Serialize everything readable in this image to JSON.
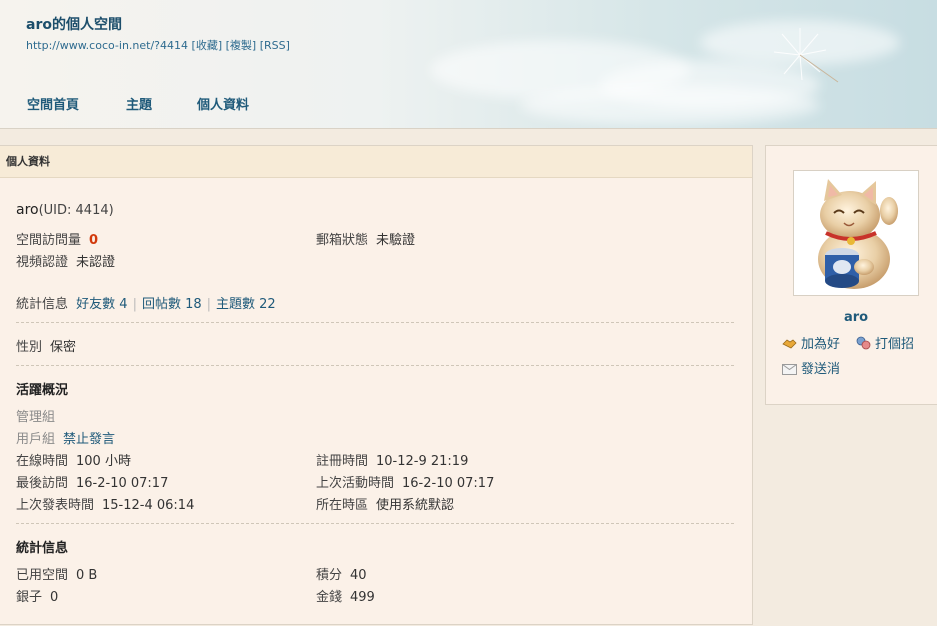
{
  "header": {
    "title": "aro的個人空間",
    "url": "http://www.coco-in.net/?4414",
    "links": [
      "[收藏]",
      "[複製]",
      "[RSS]"
    ]
  },
  "nav": [
    "空間首頁",
    "主題",
    "個人資料"
  ],
  "main": {
    "panel_title": "個人資料",
    "username": "aro",
    "uid_text": "(UID: 4414)",
    "visits_label": "空間訪問量",
    "visits_value": "0",
    "email_label": "郵箱狀態",
    "email_value": "未驗證",
    "video_label": "視頻認證",
    "video_value": "未認證",
    "stats_label": "統計信息",
    "friends": "好友數 4",
    "replies": "回帖數 18",
    "threads": "主題數 22",
    "gender_label": "性別",
    "gender_value": "保密",
    "activity_title": "活躍概況",
    "admin_group_label": "管理組",
    "user_group_label": "用戶組",
    "user_group_value": "禁止發言",
    "online_label": "在線時間",
    "online_value": "100 小時",
    "reg_label": "註冊時間",
    "reg_value": "10-12-9 21:19",
    "last_visit_label": "最後訪問",
    "last_visit_value": "16-2-10 07:17",
    "last_active_label": "上次活動時間",
    "last_active_value": "16-2-10 07:17",
    "last_post_label": "上次發表時間",
    "last_post_value": "15-12-4 06:14",
    "tz_label": "所在時區",
    "tz_value": "使用系統默認",
    "stats_title": "統計信息",
    "space_label": "已用空間",
    "space_value": "0 B",
    "points_label": "積分",
    "points_value": "40",
    "silver_label": "銀子",
    "silver_value": "0",
    "gold_label": "金錢",
    "gold_value": "499"
  },
  "side": {
    "username": "aro",
    "add_friend": "加為好",
    "greet": "打個招",
    "message": "發送消"
  },
  "colors": {
    "link": "#1f5a7a",
    "highlight": "#d23a0c",
    "panel_bg": "#fbf1e8",
    "panel_header": "#f7ebd7"
  }
}
